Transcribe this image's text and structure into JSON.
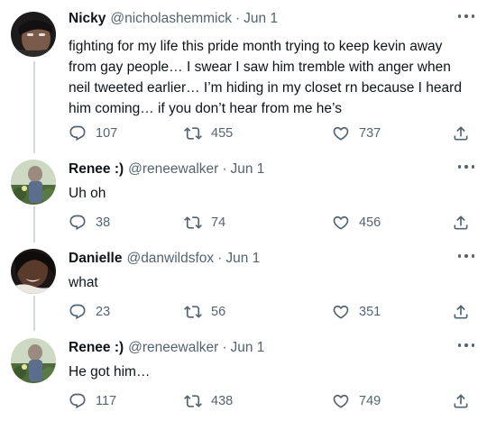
{
  "tweets": [
    {
      "name": "Nicky",
      "handle": "@nicholashemmick",
      "dot": "·",
      "date": "Jun 1",
      "text": "fighting for my life this pride month trying to keep kevin away from gay people… I swear I saw him tremble with anger when neil tweeted earlier… I’m hiding in my closet rn because I heard him coming… if you don’t hear from me he’s",
      "replies": "107",
      "retweets": "455",
      "likes": "737"
    },
    {
      "name": "Renee :)",
      "handle": "@reneewalker",
      "dot": "·",
      "date": "Jun 1",
      "text": "Uh oh",
      "replies": "38",
      "retweets": "74",
      "likes": "456"
    },
    {
      "name": "Danielle",
      "handle": "@danwildsfox",
      "dot": "·",
      "date": "Jun 1",
      "text": "what",
      "replies": "23",
      "retweets": "56",
      "likes": "351"
    },
    {
      "name": "Renee :)",
      "handle": "@reneewalker",
      "dot": "·",
      "date": "Jun 1",
      "text": "He got him…",
      "replies": "117",
      "retweets": "438",
      "likes": "749"
    }
  ],
  "colors": {
    "text_primary": "#0f1419",
    "text_secondary": "#536471",
    "thread_line": "#cfd9de"
  },
  "icons": {
    "reply": "speech-bubble-icon",
    "retweet": "retweet-arrows-icon",
    "like": "heart-icon",
    "share": "share-upload-icon",
    "more": "three-dots-icon"
  }
}
